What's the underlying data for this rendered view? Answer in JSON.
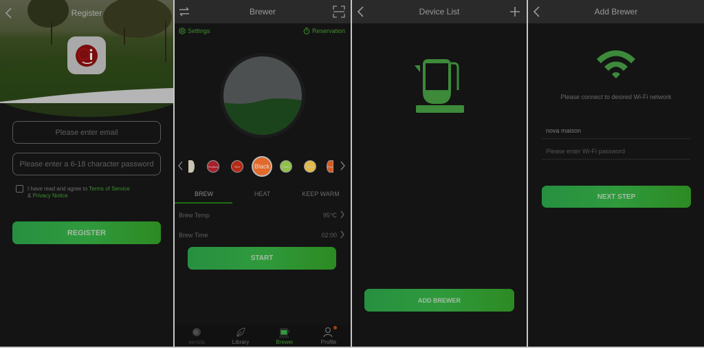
{
  "register": {
    "title": "Register",
    "email_placeholder": "Please enter email",
    "password_placeholder": "Please enter a 6-18 character password",
    "agree_text": "I have read and agree to ",
    "terms_link": "Terms of Service",
    "amp": "& ",
    "privacy_link": "Privacy Notice",
    "register_button": "REGISTER",
    "logo_text": "Qi"
  },
  "brewer": {
    "title": "Brewer",
    "settings_label": "Settings",
    "reservation_label": "Reservation",
    "fill_level": 0.45,
    "teas": [
      {
        "label": "",
        "color": "#c9c4b0"
      },
      {
        "label": "Rooibos",
        "color": "#a8202a"
      },
      {
        "label": "Red",
        "color": "#b52a14"
      },
      {
        "label": "Black",
        "color": "#e2692a",
        "selected": true
      },
      {
        "label": "Green",
        "color": "#8fc04a"
      },
      {
        "label": "White",
        "color": "#e3b84a"
      },
      {
        "label": "Puer",
        "color": "#d95a20"
      }
    ],
    "tabs": [
      {
        "label": "BREW",
        "active": true
      },
      {
        "label": "HEAT",
        "active": false
      },
      {
        "label": "KEEP WARM",
        "active": false
      }
    ],
    "settings_rows": [
      {
        "label": "Brew Temp",
        "value": "95℃"
      },
      {
        "label": "Brew Time",
        "value": "02:00"
      }
    ],
    "start_button": "START",
    "nav": [
      {
        "label": "aerista",
        "icon": "aerista-icon",
        "active": false
      },
      {
        "label": "Library",
        "icon": "leaf-icon",
        "active": false
      },
      {
        "label": "Brewer",
        "icon": "brewer-icon",
        "active": true
      },
      {
        "label": "Profile",
        "icon": "profile-icon",
        "active": false,
        "badge": true
      }
    ]
  },
  "device_list": {
    "title": "Device List",
    "add_button": "ADD BREWER"
  },
  "add_brewer": {
    "title": "Add Brewer",
    "instruction": "Please connect to desired Wi-Fi network",
    "ssid_value": "nova maison",
    "password_placeholder": "Please enter Wi-Fi password",
    "next_button": "NEXT STEP"
  },
  "colors": {
    "accent_green": "#2f9a3c",
    "link_green": "#3c8d2f",
    "background": "#141414",
    "topbar": "#2a2a2a"
  }
}
